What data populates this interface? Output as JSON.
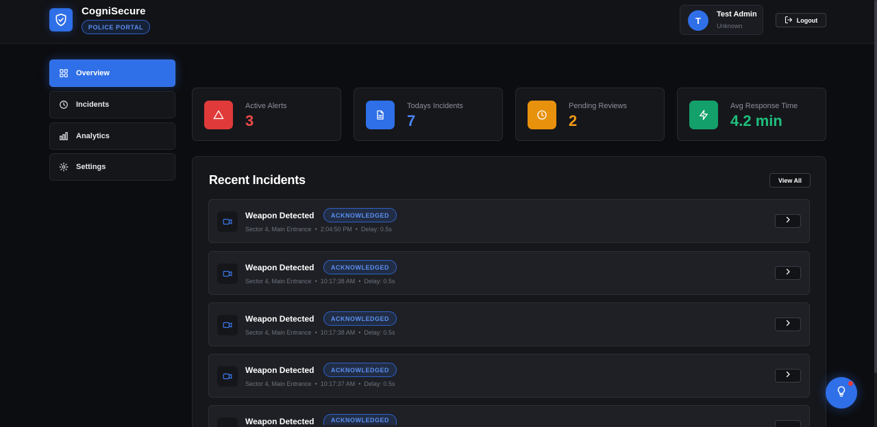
{
  "header": {
    "app_name": "CogniSecure",
    "portal_badge": "POLICE PORTAL",
    "user": {
      "initial": "T",
      "name": "Test Admin",
      "role": "Unknown"
    },
    "logout_label": "Logout"
  },
  "sidebar": {
    "items": [
      {
        "label": "Overview",
        "icon": "grid-icon",
        "active": true
      },
      {
        "label": "Incidents",
        "icon": "clock-icon",
        "active": false
      },
      {
        "label": "Analytics",
        "icon": "bar-chart-icon",
        "active": false
      },
      {
        "label": "Settings",
        "icon": "gear-icon",
        "active": false
      }
    ]
  },
  "stats": [
    {
      "label": "Active Alerts",
      "value": "3",
      "icon": "alert-triangle-icon",
      "color": "#e03a3a",
      "value_color": "#ef4a4a"
    },
    {
      "label": "Todays Incidents",
      "value": "7",
      "icon": "document-icon",
      "color": "#2f6fe8",
      "value_color": "#4a86f5"
    },
    {
      "label": "Pending Reviews",
      "value": "2",
      "icon": "clock-icon",
      "color": "#e8910c",
      "value_color": "#f39c12"
    },
    {
      "label": "Avg Response Time",
      "value": "4.2 min",
      "icon": "lightning-icon",
      "color": "#14a06a",
      "value_color": "#1fbf7d"
    }
  ],
  "incidents": {
    "title": "Recent Incidents",
    "view_all_label": "View All",
    "items": [
      {
        "title": "Weapon Detected",
        "status": "ACKNOWLEDGED",
        "location": "Sector 4, Main Entrance",
        "time": "2:04:50 PM",
        "delay": "Delay: 0.5s"
      },
      {
        "title": "Weapon Detected",
        "status": "ACKNOWLEDGED",
        "location": "Sector 4, Main Entrance",
        "time": "10:17:38 AM",
        "delay": "Delay: 0.5s"
      },
      {
        "title": "Weapon Detected",
        "status": "ACKNOWLEDGED",
        "location": "Sector 4, Main Entrance",
        "time": "10:17:38 AM",
        "delay": "Delay: 0.5s"
      },
      {
        "title": "Weapon Detected",
        "status": "ACKNOWLEDGED",
        "location": "Sector 4, Main Entrance",
        "time": "10:17:37 AM",
        "delay": "Delay: 0.5s"
      },
      {
        "title": "Weapon Detected",
        "status": "ACKNOWLEDGED",
        "location": "",
        "time": "",
        "delay": ""
      }
    ]
  },
  "fab": {
    "icon": "lightbulb-icon"
  },
  "colors": {
    "accent": "#2f6fe8",
    "background": "#0c0d10",
    "notification": "#e53b3b"
  }
}
